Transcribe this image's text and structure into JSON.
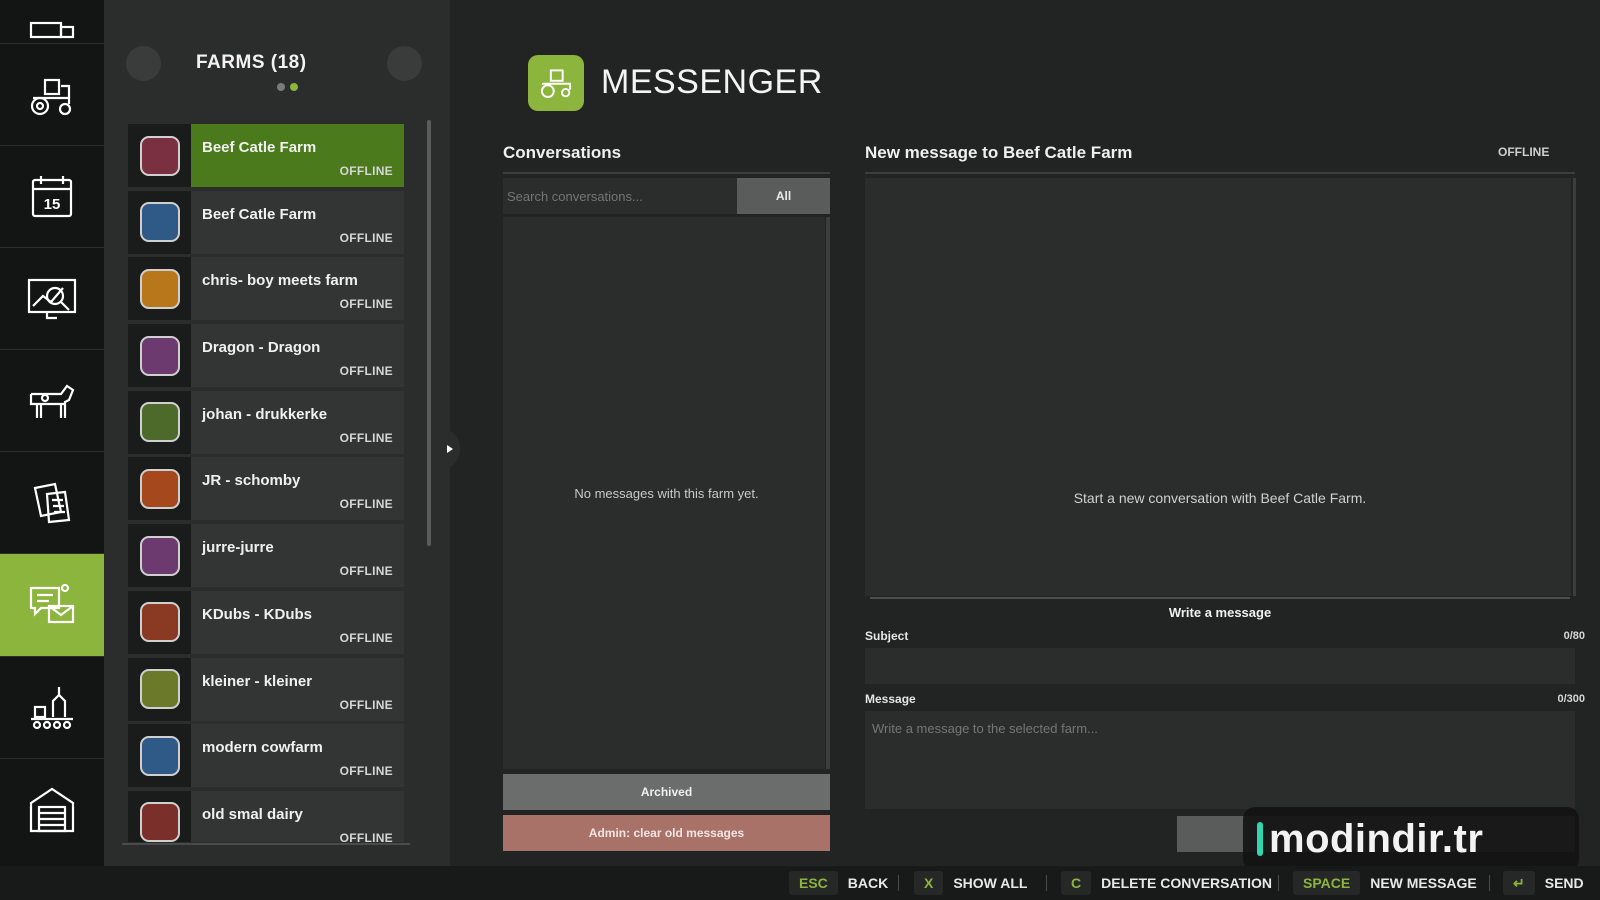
{
  "nav": {
    "items": [
      {
        "icon": "tractor-trailer-icon",
        "active": false
      },
      {
        "icon": "tractor-icon",
        "active": false
      },
      {
        "icon": "calendar-icon",
        "active": false,
        "badge_text": "15"
      },
      {
        "icon": "statistics-icon",
        "active": false
      },
      {
        "icon": "cow-icon",
        "active": false
      },
      {
        "icon": "contracts-icon",
        "active": false
      },
      {
        "icon": "messenger-icon",
        "active": true
      },
      {
        "icon": "production-icon",
        "active": false
      },
      {
        "icon": "garage-icon",
        "active": false
      }
    ]
  },
  "farms": {
    "title": "FARMS (18)",
    "page_dots": 2,
    "current_page": 2,
    "list": [
      {
        "name": "Beef Catle Farm",
        "status": "OFFLINE",
        "selected": true,
        "badge_color": "#7a3040"
      },
      {
        "name": "Beef Catle Farm",
        "status": "OFFLINE",
        "selected": false,
        "badge_color": "#2f5a88"
      },
      {
        "name": "chris- boy meets farm",
        "status": "OFFLINE",
        "selected": false,
        "badge_color": "#b9771c"
      },
      {
        "name": "Dragon - Dragon",
        "status": "OFFLINE",
        "selected": false,
        "badge_color": "#6d3a6f"
      },
      {
        "name": "johan - drukkerke",
        "status": "OFFLINE",
        "selected": false,
        "badge_color": "#4e6a2a"
      },
      {
        "name": "JR - schomby",
        "status": "OFFLINE",
        "selected": false,
        "badge_color": "#a5481e"
      },
      {
        "name": "jurre-jurre",
        "status": "OFFLINE",
        "selected": false,
        "badge_color": "#6d3a6f"
      },
      {
        "name": "KDubs - KDubs",
        "status": "OFFLINE",
        "selected": false,
        "badge_color": "#8a3a22"
      },
      {
        "name": "kleiner - kleiner",
        "status": "OFFLINE",
        "selected": false,
        "badge_color": "#6b7a2a"
      },
      {
        "name": "modern cowfarm",
        "status": "OFFLINE",
        "selected": false,
        "badge_color": "#2f5a88"
      },
      {
        "name": "old smal dairy",
        "status": "OFFLINE",
        "selected": false,
        "badge_color": "#7a2f2a"
      }
    ]
  },
  "header": {
    "title": "MESSENGER",
    "icon": "tractor-icon"
  },
  "conversations": {
    "title": "Conversations",
    "search_placeholder": "Search conversations...",
    "filter_label": "All",
    "empty_text": "No messages with this farm yet.",
    "archived_label": "Archived",
    "admin_label": "Admin: clear old messages"
  },
  "compose": {
    "title": "New message to Beef Catle Farm",
    "status": "OFFLINE",
    "empty_text": "Start a new conversation with Beef Catle Farm.",
    "write_label": "Write a message",
    "subject_label": "Subject",
    "subject_counter": "0/80",
    "message_label": "Message",
    "message_counter": "0/300",
    "message_placeholder": "Write a message to the selected farm..."
  },
  "watermark": {
    "text": "modindir.tr"
  },
  "footer": {
    "hints": [
      {
        "key": "ESC",
        "label": "BACK"
      },
      {
        "key": "X",
        "label": "SHOW ALL"
      },
      {
        "key": "C",
        "label": "DELETE CONVERSATION"
      },
      {
        "key": "SPACE",
        "label": "NEW MESSAGE"
      },
      {
        "key": "↵",
        "label": "SEND"
      }
    ]
  },
  "colors": {
    "accent": "#8cb53d",
    "selected_row": "#4b7a1c",
    "danger_button": "#a97268"
  }
}
